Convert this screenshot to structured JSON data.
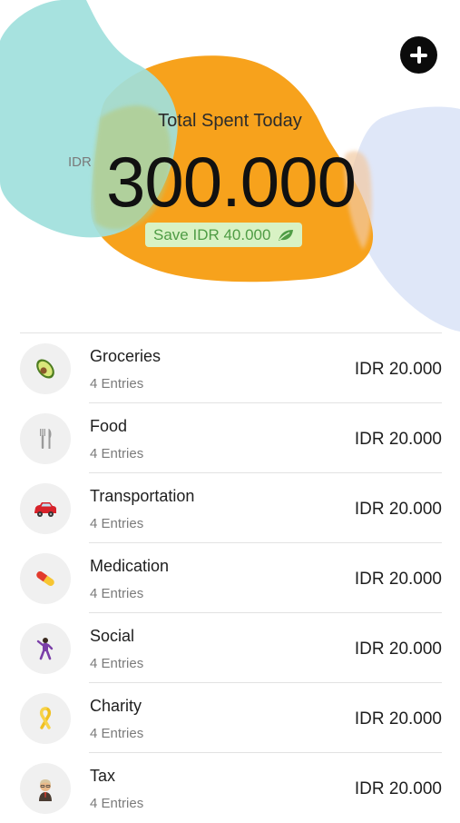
{
  "header": {
    "title": "Total Spent Today",
    "currency": "IDR",
    "total": "300.000",
    "save_label": "Save IDR 40.000",
    "add_icon": "plus-icon",
    "save_icon": "leaf-icon",
    "colors": {
      "teal_blob": "#9fe0dc",
      "orange_blob": "#f7a21c",
      "blue_blob": "#dbe5f7",
      "badge_bg": "#d8f2c4",
      "badge_text": "#4f9c45"
    }
  },
  "categories": [
    {
      "name": "Groceries",
      "entries": "4 Entries",
      "amount": "IDR 20.000",
      "icon": "avocado-icon"
    },
    {
      "name": "Food",
      "entries": "4 Entries",
      "amount": "IDR 20.000",
      "icon": "fork-knife-icon"
    },
    {
      "name": "Transportation",
      "entries": "4 Entries",
      "amount": "IDR 20.000",
      "icon": "car-icon"
    },
    {
      "name": "Medication",
      "entries": "4 Entries",
      "amount": "IDR 20.000",
      "icon": "pill-icon"
    },
    {
      "name": "Social",
      "entries": "4 Entries",
      "amount": "IDR 20.000",
      "icon": "dancer-icon"
    },
    {
      "name": "Charity",
      "entries": "4 Entries",
      "amount": "IDR 20.000",
      "icon": "ribbon-icon"
    },
    {
      "name": "Tax",
      "entries": "4 Entries",
      "amount": "IDR 20.000",
      "icon": "officer-icon"
    }
  ]
}
